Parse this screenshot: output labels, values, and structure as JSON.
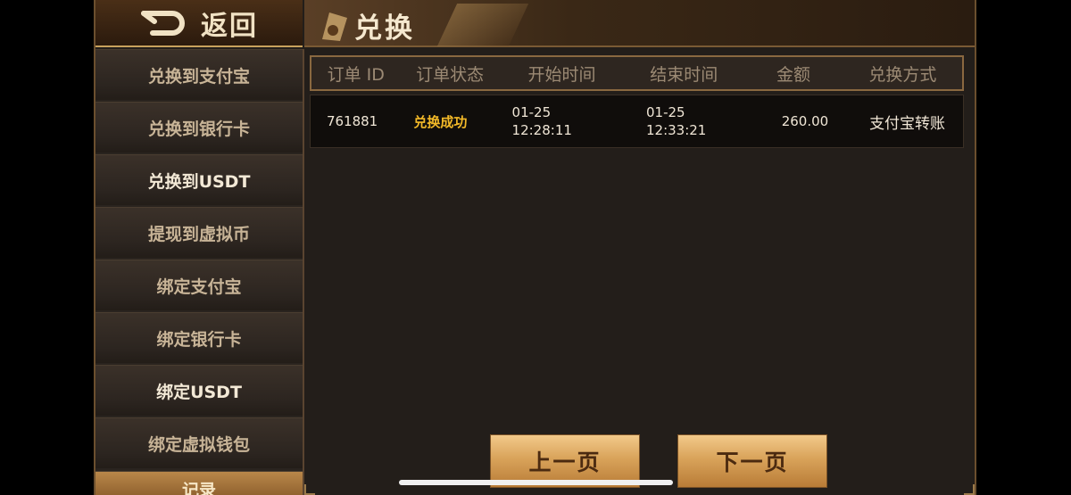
{
  "back": {
    "label": "返回"
  },
  "header": {
    "title": "兑换"
  },
  "sidebar": {
    "items": [
      {
        "label": "兑换到支付宝"
      },
      {
        "label": "兑换到银行卡"
      },
      {
        "label": "兑换到USDT"
      },
      {
        "label": "提现到虚拟币"
      },
      {
        "label": "绑定支付宝"
      },
      {
        "label": "绑定银行卡"
      },
      {
        "label": "绑定USDT"
      },
      {
        "label": "绑定虚拟钱包"
      },
      {
        "label": "记录"
      }
    ]
  },
  "table": {
    "columns": [
      "订单 ID",
      "订单状态",
      "开始时间",
      "结束时间",
      "金额",
      "兑换方式"
    ],
    "rows": [
      {
        "order_id": "761881",
        "status": "兑换成功",
        "start_date": "01-25",
        "start_time": "12:28:11",
        "end_date": "01-25",
        "end_time": "12:33:21",
        "amount": "260.00",
        "method": "支付宝转账"
      }
    ]
  },
  "pagination": {
    "prev_label": "上一页",
    "next_label": "下一页"
  },
  "colors": {
    "accent": "#f3b928",
    "gold_button": "#d9a35a",
    "panel": "#231e1a"
  }
}
